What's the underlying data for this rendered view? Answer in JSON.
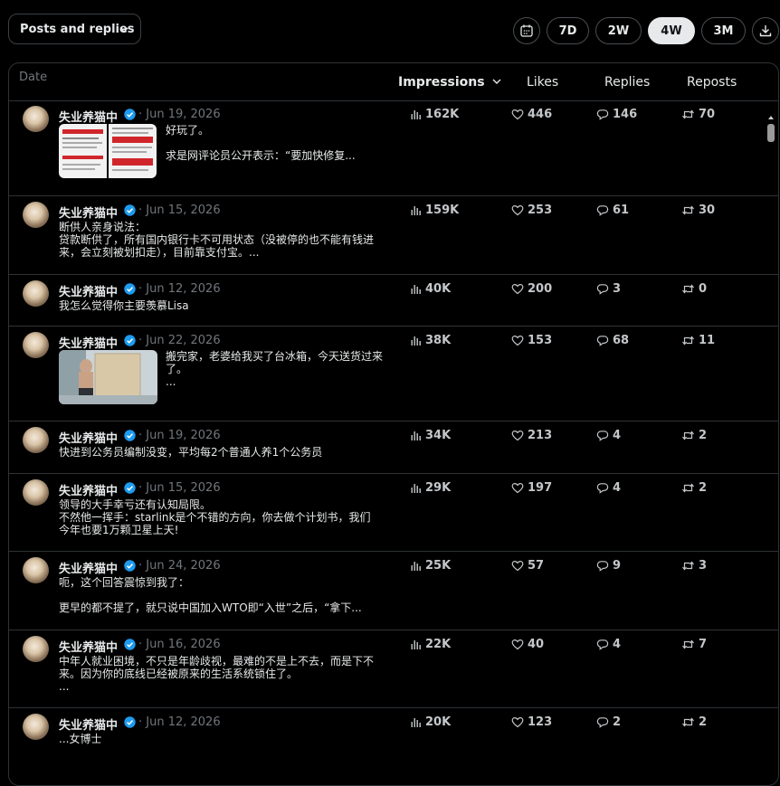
{
  "toolbar": {
    "filter_label": "Posts and replies",
    "ranges": [
      "7D",
      "2W",
      "4W",
      "3M"
    ],
    "active_range": "4W"
  },
  "table": {
    "headers": {
      "date": "Date",
      "impressions": "Impressions",
      "likes": "Likes",
      "replies": "Replies",
      "reposts": "Reposts"
    },
    "rows": [
      {
        "author": "失业养猫中",
        "date": "· Jun 19, 2026",
        "text": "好玩了。\n\n求是网评论员公开表示：“要加快修复...",
        "impressions": "162K",
        "likes": "446",
        "replies": "146",
        "reposts": "70",
        "media": "news-screenshots"
      },
      {
        "author": "失业养猫中",
        "date": "· Jun 15, 2026",
        "text": "断供人亲身说法：\n贷款断供了，所有国内银行卡不可用状态（没被停的也不能有钱进来，会立刻被划扣走），目前靠支付宝。...",
        "impressions": "159K",
        "likes": "253",
        "replies": "61",
        "reposts": "30",
        "media": ""
      },
      {
        "author": "失业养猫中",
        "date": "· Jun 12, 2026",
        "text": "我怎么觉得你主要羡慕Lisa",
        "impressions": "40K",
        "likes": "200",
        "replies": "3",
        "reposts": "0",
        "media": ""
      },
      {
        "author": "失业养猫中",
        "date": "· Jun 22, 2026",
        "text": "搬完家，老婆给我买了台冰箱，今天送货过来了。\n...",
        "impressions": "38K",
        "likes": "153",
        "replies": "68",
        "reposts": "11",
        "media": "room-photo"
      },
      {
        "author": "失业养猫中",
        "date": "· Jun 19, 2026",
        "text": "快进到公务员编制没变，平均每2个普通人养1个公务员",
        "impressions": "34K",
        "likes": "213",
        "replies": "4",
        "reposts": "2",
        "media": ""
      },
      {
        "author": "失业养猫中",
        "date": "· Jun 15, 2026",
        "text": "领导的大手幸亏还有认知局限。\n不然他一挥手：starlink是个不错的方向，你去做个计划书，我们今年也要1万颗卫星上天!",
        "impressions": "29K",
        "likes": "197",
        "replies": "4",
        "reposts": "2",
        "media": ""
      },
      {
        "author": "失业养猫中",
        "date": "· Jun 24, 2026",
        "text": "呃，这个回答震惊到我了：\n\n更早的都不提了，就只说中国加入WTO即“入世”之后，“拿下...",
        "impressions": "25K",
        "likes": "57",
        "replies": "9",
        "reposts": "3",
        "media": ""
      },
      {
        "author": "失业养猫中",
        "date": "· Jun 16, 2026",
        "text": "中年人就业困境，不只是年龄歧视，最难的不是上不去，而是下不来。因为你的底线已经被原来的生活系统锁住了。\n...",
        "impressions": "22K",
        "likes": "40",
        "replies": "4",
        "reposts": "7",
        "media": ""
      },
      {
        "author": "失业养猫中",
        "date": "· Jun 12, 2026",
        "text": "...女博士",
        "impressions": "20K",
        "likes": "123",
        "replies": "2",
        "reposts": "2",
        "media": ""
      }
    ]
  },
  "colors": {
    "background": "#000000",
    "border": "#2f3336",
    "text": "#e7e9ea",
    "muted": "#71767b",
    "verified": "#1d9bf0"
  },
  "icons": [
    "chevron-down-icon",
    "calendar-icon",
    "download-icon",
    "verified-badge-icon",
    "impressions-chart-icon",
    "heart-icon",
    "reply-bubble-icon",
    "repost-icon"
  ]
}
